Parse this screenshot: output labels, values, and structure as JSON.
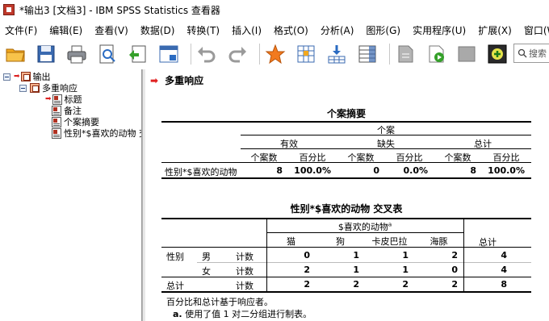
{
  "window": {
    "title": "*输出3 [文档3] - IBM SPSS Statistics 查看器"
  },
  "menu": [
    "文件(F)",
    "编辑(E)",
    "查看(V)",
    "数据(D)",
    "转换(T)",
    "插入(I)",
    "格式(O)",
    "分析(A)",
    "图形(G)",
    "实用程序(U)",
    "扩展(X)",
    "窗口(W)"
  ],
  "search": {
    "placeholder": "搜索"
  },
  "nav": {
    "root": "输出",
    "group": "多重响应",
    "items": [
      "标题",
      "备注",
      "个案摘要",
      "性别*$喜欢的动物 交叉表"
    ]
  },
  "output": {
    "section_heading": "多重响应",
    "summary_table": {
      "title": "个案摘要",
      "top_header": "个案",
      "groups": [
        "有效",
        "缺失",
        "总计"
      ],
      "subheaders": [
        "个案数",
        "百分比",
        "个案数",
        "百分比",
        "个案数",
        "百分比"
      ],
      "row_label": "性别*$喜欢的动物",
      "row_values": [
        "8",
        "100.0%",
        "0",
        "0.0%",
        "8",
        "100.0%"
      ]
    },
    "cross_table": {
      "title": "性别*$喜欢的动物 交叉表",
      "top_header": "$喜欢的动物",
      "top_header_sup": "a",
      "columns": [
        "猫",
        "狗",
        "卡皮巴拉",
        "海豚"
      ],
      "total_col": "总计",
      "rows": [
        {
          "label1": "性别",
          "label2": "男",
          "stat": "计数",
          "values": [
            "0",
            "1",
            "1",
            "2"
          ],
          "total": "4"
        },
        {
          "label1": "",
          "label2": "女",
          "stat": "计数",
          "values": [
            "2",
            "1",
            "1",
            "0"
          ],
          "total": "4"
        },
        {
          "label1": "总计",
          "label2": "",
          "stat": "计数",
          "values": [
            "2",
            "2",
            "2",
            "2"
          ],
          "total": "8"
        }
      ],
      "footnote1": "百分比和总计基于响应者。",
      "footnote2_marker": "a.",
      "footnote2": "使用了值 1 对二分组进行制表。"
    }
  }
}
